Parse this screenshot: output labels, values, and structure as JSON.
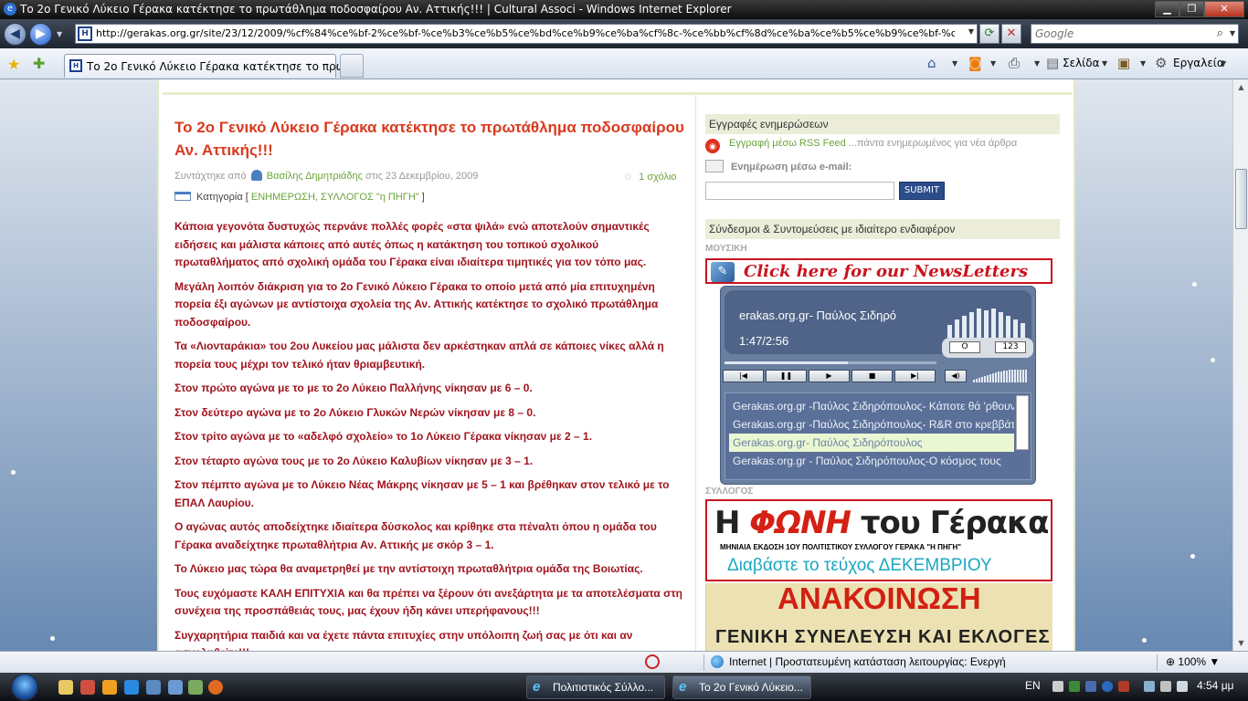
{
  "window": {
    "title": "Το 2ο Γενικό Λύκειο Γέρακα κατέκτησε το πρωτάθλημα ποδοσφαίρου Αν. Αττικής!!! | Cultural Associ - Windows Internet Explorer"
  },
  "addressbar": {
    "url": "http://gerakas.org.gr/site/23/12/2009/%cf%84%ce%bf-2%ce%bf-%ce%b3%ce%b5%ce%bd%ce%b9%ce%ba%cf%8c-%ce%bb%cf%8d%ce%ba%ce%b5%ce%b9%ce%bf-%ce%b3%",
    "search_placeholder": "Google"
  },
  "tabs": {
    "active_label": "Το 2ο Γενικό Λύκειο Γέρακα κατέκτησε το πρωτ..."
  },
  "commandbar": {
    "page": "Σελίδα",
    "tools": "Εργαλεία"
  },
  "post": {
    "title": "Το 2ο Γενικό Λύκειο Γέρακα κατέκτησε το πρωτάθλημα ποδοσφαίρου Αν. Αττικής!!!",
    "meta_prefix": "Συντάχτηκε από",
    "author": "Βασίλης Δημητριάδης",
    "date": "στις 23 Δεκεμβρίου, 2009",
    "comments": "1 σχόλιο",
    "category_label": "Κατηγορία [",
    "category_links": "ΕΝΗΜΕΡΩΣΗ, ΣΥΛΛΟΓΟΣ \"η ΠΗΓΗ\"",
    "category_end": "]",
    "paragraphs": [
      "Κάποια γεγονότα δυστυχώς περνάνε πολλές φορές «στα ψιλά» ενώ αποτελούν σημαντικές ειδήσεις και μάλιστα κάποιες από αυτές όπως η κατάκτηση του τοπικού σχολικού πρωταθλήματος από σχολική ομάδα του Γέρακα είναι ιδιαίτερα τιμητικές για τον τόπο μας.",
      "Μεγάλη λοιπόν διάκριση για το 2ο Γενικό Λύκειο Γέρακα το οποίο μετά από μία επιτυχημένη πορεία έξι αγώνων με αντίστοιχα σχολεία της Αν. Αττικής κατέκτησε το σχολικό πρωτάθλημα ποδοσφαίρου.",
      "Τα «Λιονταράκια» του 2ου Λυκείου μας μάλιστα δεν αρκέστηκαν απλά σε κάποιες νίκες αλλά η πορεία τους μέχρι τον τελικό ήταν θριαμβευτική.",
      "Στον πρώτο αγώνα με το με το 2ο Λύκειο Παλλήνης νίκησαν με 6 – 0.",
      "Στον δεύτερο αγώνα με το 2ο Λύκειο Γλυκών Νερών νίκησαν με 8 – 0.",
      "Στον τρίτο αγώνα με το «αδελφό σχολείο» το 1ο Λύκειο Γέρακα νίκησαν με 2 – 1.",
      "Στον τέταρτο αγώνα τους με το 2ο Λύκειο Καλυβίων νίκησαν με 3 – 1.",
      "Στον πέμπτο αγώνα με το Λύκειο Νέας Μάκρης νίκησαν με 5 – 1 και βρέθηκαν στον τελικό με το ΕΠΑΛ Λαυρίου.",
      "Ο αγώνας αυτός αποδείχτηκε ιδιαίτερα δύσκολος και κρίθηκε στα πέναλτι όπου η ομάδα του Γέρακα αναδείχτηκε πρωταθλήτρια Αν. Αττικής με σκόρ 3 – 1.",
      "Το Λύκειο μας τώρα θα αναμετρηθεί με την αντίστοιχη πρωταθλήτρια ομάδα της Βοιωτίας.",
      "Τους ευχόμαστε ΚΑΛΗ ΕΠΙΤΥΧΙΑ και θα πρέπει να ξέρουν ότι ανεξάρτητα με τα αποτελέσματα στη συνέχεια της προσπάθειάς τους, μας έχουν ήδη κάνει υπερήφανους!!!",
      "Συγχαρητήρια παιδιά και να έχετε πάντα επιτυχίες στην υπόλοιπη ζωή σας με ότι και αν ασχοληθείτε!!!"
    ]
  },
  "sidebar": {
    "subscriptions_heading": "Εγγραφές ενημερώσεων",
    "rss_link": "Εγγραφή μέσω RSS Feed",
    "rss_note": "...πάντα ενημερωμένος για νέα άρθρα",
    "email_label": "Ενημέρωση μέσω e-mail:",
    "submit": "SUBMIT",
    "links_heading": "Σύνδεσμοι & Συντομεύσεις με ιδιαίτερο ενδιαφέρον",
    "music_label": "ΜΟΥΣΙΚΗ",
    "newsletter": "Click here for our NewsLetters",
    "association_label": "ΣΥΛΛΟΓΟΣ",
    "fwni_title_a": "Η ",
    "fwni_title_b": "ΦΩΝΗ",
    "fwni_title_c": " του Γέρακα",
    "fwni_subtitle": "ΜΗΝΙΑΙΑ ΕΚΔΟΣΗ 1ΟΥ ΠΟΛΙΤΙΣΤΙΚΟΥ ΣΥΛΛΟΓΟΥ ΓΕΡΑΚΑ \"Η ΠΗΓΗ\"",
    "fwni_read": "Διαβάστε το τεύχος ΔΕΚΕΜΒΡΙΟΥ",
    "announcement_title": "ΑΝΑΚΟΙΝΩΣΗ",
    "announcement_sub": "ΓΕΝΙΚΗ ΣΥΝΕΛΕΥΣΗ ΚΑΙ ΕΚΛΟΓΕΣ"
  },
  "player": {
    "track": "erakas.org.gr- Παύλος Σιδηρό",
    "time": "1:47/2:56",
    "progress": 0.58,
    "mode_left": "O",
    "mode_right": "123",
    "playlist": [
      "Gerakas.org.gr -Παύλος Σιδηρόπουλος- Κάποτε θά 'ρθουν",
      "Gerakas.org.gr -Παύλος Σιδηρόπουλος- R&R στο κρεββάτι",
      "Gerakas.org.gr- Παύλος Σιδηρόπουλος",
      "Gerakas.org.gr - Παύλος Σιδηρόπουλος-Ο κόσμος τους"
    ]
  },
  "statusbar": {
    "zone": "Internet | Προστατευμένη κατάσταση λειτουργίας: Ενεργή",
    "zoom": "100%"
  },
  "taskbar": {
    "task1": "Πολιτιστικός Σύλλο...",
    "task2": "Το 2ο Γενικό Λύκειο...",
    "lang": "EN",
    "clock": "4:54 μμ"
  }
}
